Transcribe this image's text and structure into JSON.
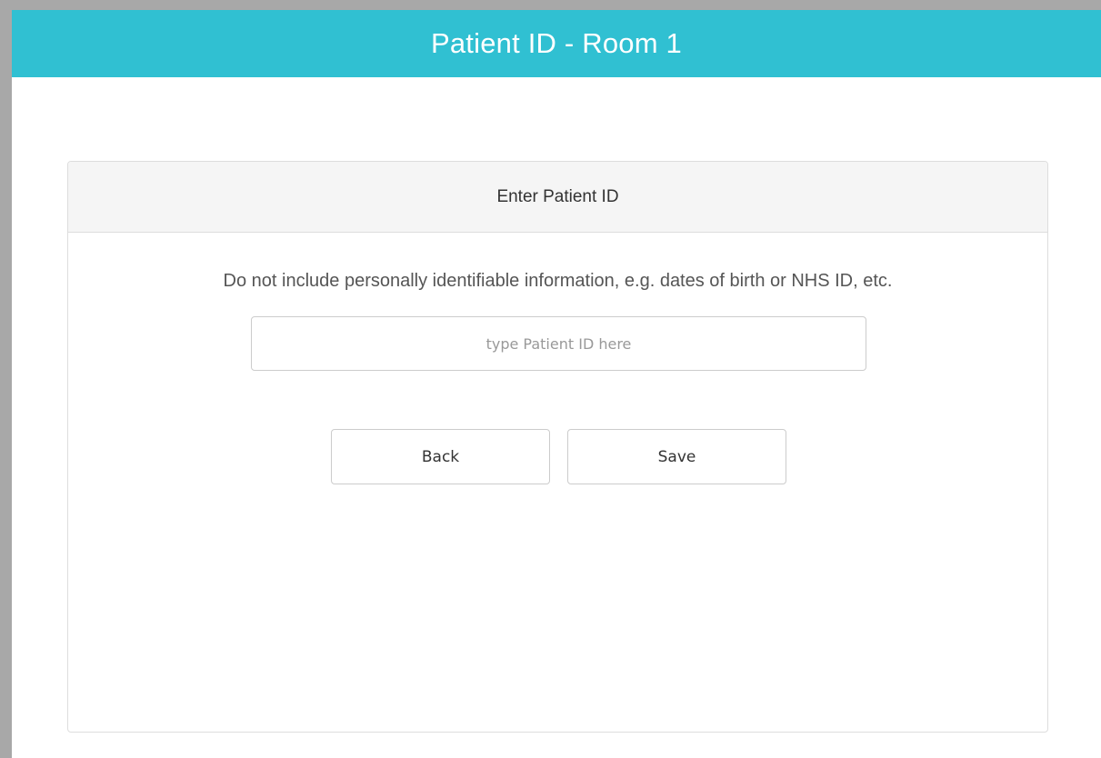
{
  "header": {
    "title": "Patient ID - Room 1",
    "background_color": "#30c0d2"
  },
  "panel": {
    "title": "Enter Patient ID",
    "notice": "Do not include personally identifiable information, e.g. dates of birth or NHS ID, etc.",
    "input": {
      "value": "",
      "placeholder": "type Patient ID here"
    },
    "buttons": {
      "back_label": "Back",
      "save_label": "Save"
    }
  }
}
